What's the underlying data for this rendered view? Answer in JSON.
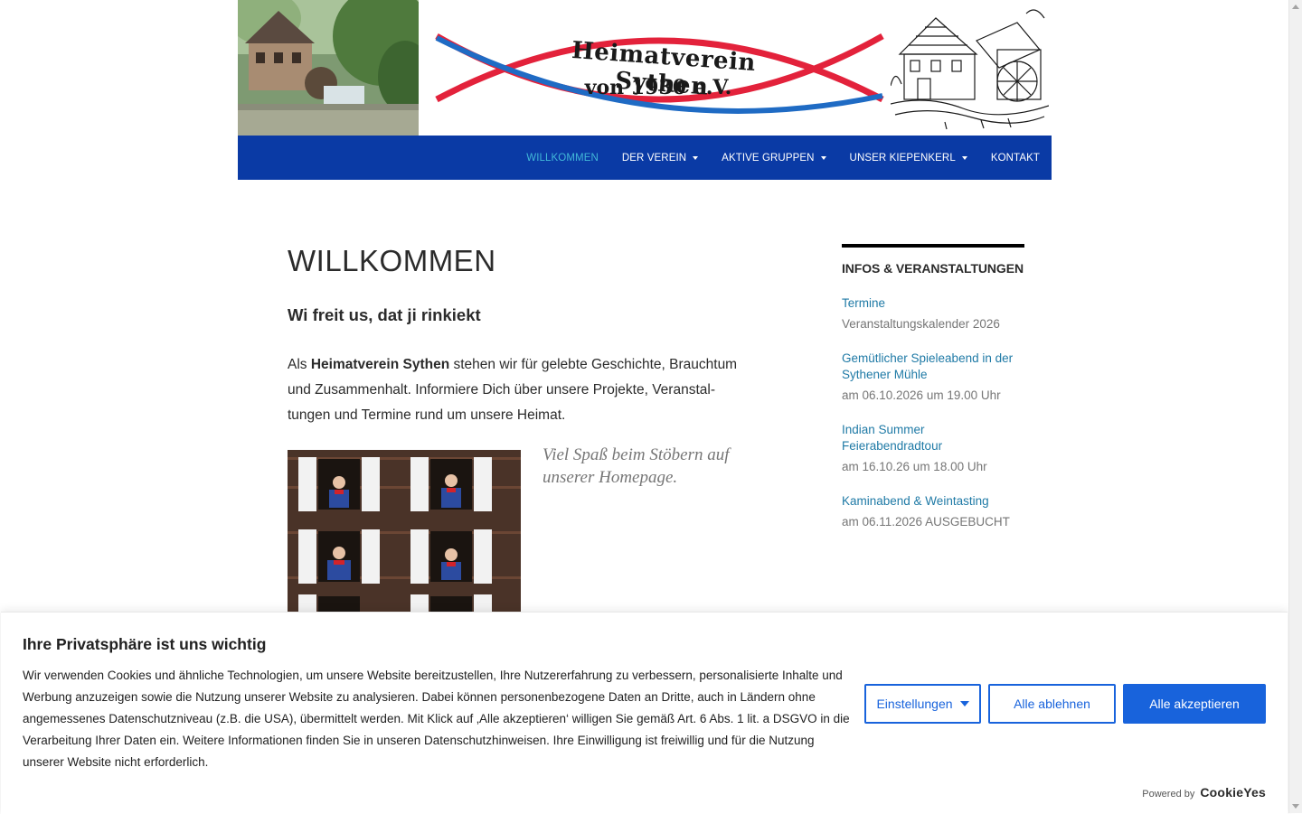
{
  "header": {
    "logo_line1": "Heimatverein Sythen",
    "logo_line2": "von 1930 e.V."
  },
  "nav": {
    "items": [
      {
        "label": "WILLKOMMEN",
        "active": true,
        "dropdown": false
      },
      {
        "label": "DER VEREIN",
        "active": false,
        "dropdown": true
      },
      {
        "label": "AKTIVE GRUPPEN",
        "active": false,
        "dropdown": true
      },
      {
        "label": "UNSER KIEPENKERL",
        "active": false,
        "dropdown": true
      },
      {
        "label": "KONTAKT",
        "active": false,
        "dropdown": false
      }
    ]
  },
  "main": {
    "title": "WILLKOMMEN",
    "subtitle": "Wi freit us, dat ji rinkiekt",
    "intro_before": "Als ",
    "intro_bold": "Heimatverein Sythen",
    "intro_after": " stehen wir für gelebte Geschichte, Brauchtum und Zusammenhalt. Informiere Dich über unsere Projekte, Veranstal­tungen und Termine rund um unsere Heimat.",
    "quote": "Viel Spaß beim Stöbern auf unserer Homepage."
  },
  "sidebar": {
    "title": "INFOS & VERANSTALTUNGEN",
    "events": [
      {
        "link": "Termine",
        "date": "Veranstaltungskalender 2026"
      },
      {
        "link": "Gemütlicher Spieleabend in der Sythener Mühle",
        "date": "am 06.10.2026 um 19.00 Uhr"
      },
      {
        "link": "Indian Summer Feierabendradtour",
        "date": "am 16.10.26 um 18.00 Uhr"
      },
      {
        "link": "Kaminabend & Weintasting",
        "date": "am 06.11.2026 AUSGEBUCHT"
      }
    ]
  },
  "cookie": {
    "title": "Ihre Privatsphäre ist uns wichtig",
    "text": "Wir verwenden Cookies und ähnliche Technologien, um unsere Website bereitzustellen, Ihre Nutzererfahrung zu verbessern, personalisierte Inhalte und Werbung anzuzeigen sowie die Nutzung unserer Website zu analysieren. Dabei können personenbezogene Daten an Dritte, auch in Ländern ohne angemessenes Datenschutzniveau (z.B. die USA), übermittelt werden. Mit Klick auf ‚Alle akzeptieren‘ willigen Sie gemäß Art. 6 Abs. 1 lit. a DSGVO in die Verarbeitung Ihrer Daten ein. Weitere Informationen finden Sie in unseren Datenschutzhinweisen. Ihre Einwilligung ist freiwillig und für die Nutzung unserer Website nicht erforderlich.",
    "settings_label": "Einstellungen",
    "reject_label": "Alle ablehnen",
    "accept_label": "Alle akzeptieren",
    "powered_label": "Powered by",
    "powered_brand": "CookieYes"
  },
  "colors": {
    "nav_bg": "#0a3aa5",
    "nav_active": "#41b7d8",
    "link": "#1f7aa6",
    "cookie_primary": "#1863dc",
    "logo_red": "#e3223b",
    "logo_blue": "#1f6bc4"
  }
}
